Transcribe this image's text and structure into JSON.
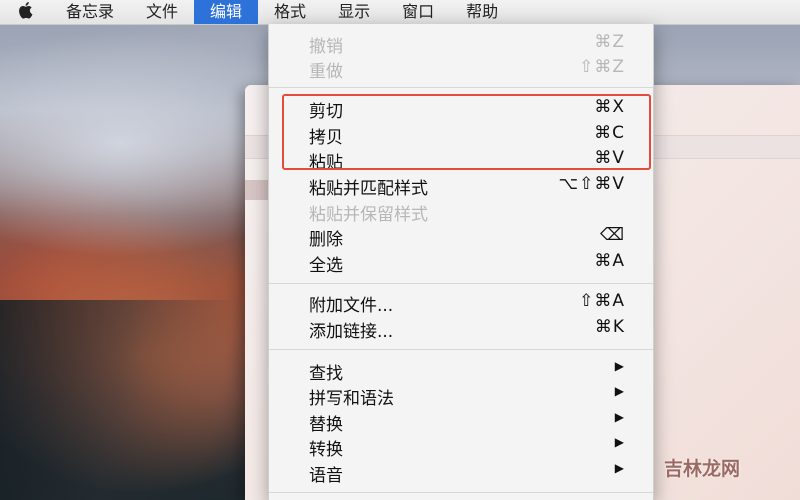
{
  "menubar": {
    "apple_icon": "",
    "items": [
      "备忘录",
      "文件",
      "编辑",
      "格式",
      "显示",
      "窗口",
      "帮助"
    ],
    "active": "编辑"
  },
  "menu": {
    "undo": {
      "label": "撤销",
      "shortcut": "⌘Z"
    },
    "redo": {
      "label": "重做",
      "shortcut": "⇧⌘Z"
    },
    "cut": {
      "label": "剪切",
      "shortcut": "⌘X"
    },
    "copy": {
      "label": "拷贝",
      "shortcut": "⌘C"
    },
    "paste": {
      "label": "粘贴",
      "shortcut": "⌘V"
    },
    "paste_match": {
      "label": "粘贴并匹配样式",
      "shortcut": "⌥⇧⌘V"
    },
    "paste_retain": {
      "label": "粘贴并保留样式",
      "shortcut": ""
    },
    "delete": {
      "label": "删除",
      "shortcut": "⌫"
    },
    "select_all": {
      "label": "全选",
      "shortcut": "⌘A"
    },
    "attach": {
      "label": "附加文件...",
      "shortcut": "⇧⌘A"
    },
    "add_link": {
      "label": "添加链接...",
      "shortcut": "⌘K"
    },
    "find": {
      "label": "查找",
      "shortcut": "▶"
    },
    "spelling": {
      "label": "拼写和语法",
      "shortcut": "▶"
    },
    "substitutions": {
      "label": "替换",
      "shortcut": "▶"
    },
    "transformations": {
      "label": "转换",
      "shortcut": "▶"
    },
    "speech": {
      "label": "语音",
      "shortcut": "▶"
    }
  },
  "highlight_color": "#e34b3c",
  "watermark": "吉林龙网"
}
